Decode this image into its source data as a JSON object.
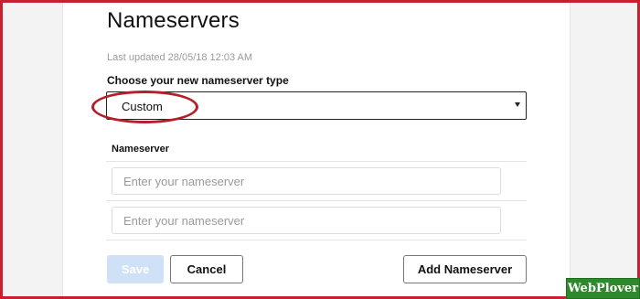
{
  "page": {
    "title": "Nameservers",
    "last_updated": "Last updated 28/05/18 12:03 AM"
  },
  "nameserver_type": {
    "label": "Choose your new nameserver type",
    "selected": "Custom"
  },
  "nameserver_list": {
    "header": "Nameserver",
    "inputs": [
      {
        "value": "",
        "placeholder": "Enter your nameserver"
      },
      {
        "value": "",
        "placeholder": "Enter your nameserver"
      }
    ]
  },
  "buttons": {
    "save": "Save",
    "cancel": "Cancel",
    "add": "Add Nameserver"
  },
  "watermark": "WebPlover",
  "colors": {
    "frame": "#c8202c",
    "highlight": "#b3202a",
    "save_disabled": "#cfe1f7",
    "watermark_bg": "#2c8a2c"
  },
  "icons": {
    "select_caret": "caret-down-icon"
  }
}
